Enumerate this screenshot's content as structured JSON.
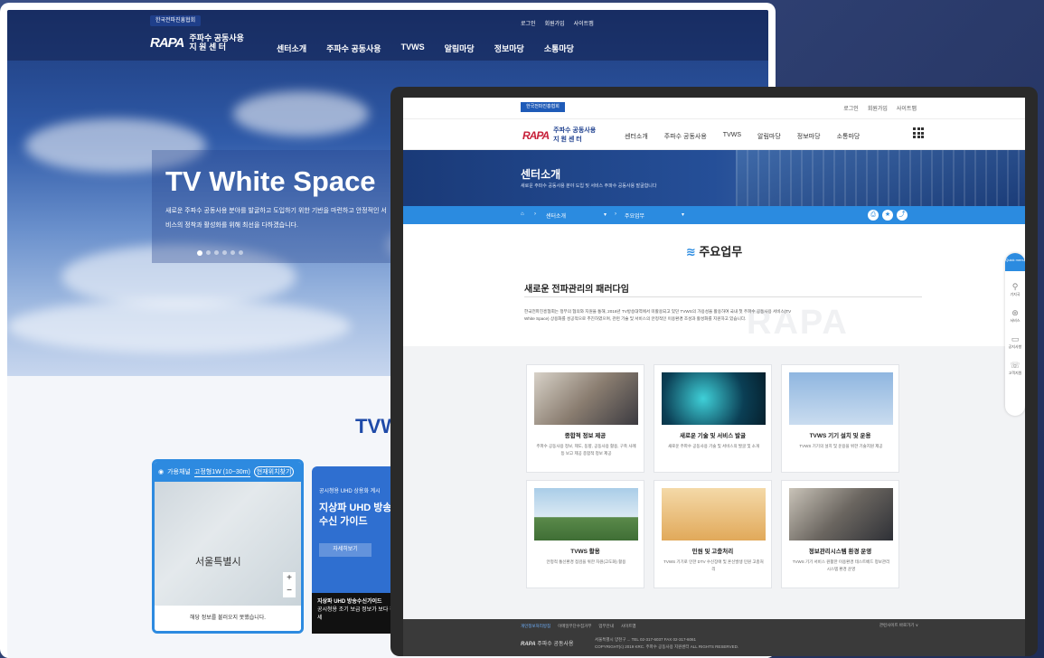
{
  "back": {
    "org_tag": "한국전파진흥협회",
    "logo_mark": "RAPA",
    "logo_line1": "주파수 공동사용",
    "logo_line2": "지 원 센 터",
    "nav": [
      "센터소개",
      "주파수 공동사용",
      "TVWS",
      "알림마당",
      "정보마당",
      "소통마당"
    ],
    "util": [
      "로그인",
      "회원가입",
      "사이트맵"
    ],
    "hero_title": "TV White Space",
    "hero_desc": "새로운 주파수 공동사용 분야를 발굴하고 도입하기 위한 기반을 마련하고 안정적인 서비스의 정착과 활성화를 위해 최선을 다하겠습니다.",
    "section_title": "TVW",
    "map_card": {
      "title": "가용채널",
      "filter": "고정형1W (10~30m)",
      "locate": "현재위치찾기",
      "city": "서울특별시",
      "footer": "해당 정보를 불러오지 못했습니다."
    },
    "guide_card": {
      "small": "공시청용 UHD 상용화 계시",
      "title": "지상파 UHD 방송 수신 가이드",
      "button": "자세히보기",
      "bottom_title": "지상파 UHD 방송수신가이드",
      "bottom_desc": "공시청용 조기 보급 정보가 보다 하세"
    }
  },
  "front": {
    "org_tag": "한국전파진흥협회",
    "util": [
      "로그인",
      "회원가입",
      "사이트맵"
    ],
    "logo_mark": "RAPA",
    "logo_line1": "주파수 공동사용",
    "logo_line2": "지 원 센 터",
    "nav": [
      "센터소개",
      "주파수 공동사용",
      "TVWS",
      "알림마당",
      "정보마당",
      "소통마당"
    ],
    "banner_title": "센터소개",
    "banner_desc": "새로운 주파수 공동사용 분야 도입 및 서비스 주파수 공동사용 발굴합니다",
    "crumbs": [
      "센터소개",
      "주요업무"
    ],
    "page_title": "주요업무",
    "section_title": "새로운 전파관리의 패러다임",
    "section_para": "한국전파진흥협회는 정부의 협의와 지원을 통해, 2016년 TV방송대역에서 미활용되고 있던 TVWS의 가용성을 활용하여 국내 첫 주파수 공동사용 서비스(TV White Space) 상용화를 성공적으로 추진하였으며, 관련 기술 및 서비스의 안정적인 이용환경 조성과 활성화를 지원하고 있습니다.",
    "watermark": "RAPA",
    "cards": [
      {
        "title": "종합적 정보 제공",
        "desc": "주파수 공동사용 정보, 제도, 동향, 공동사용 활용, 구축 사례 등 보고 제공 종합적 정보 제공"
      },
      {
        "title": "새로운 기술 및 서비스 발굴",
        "desc": "새로운 주파수 공동사용 기술 및 서비스의 발굴 및 소개"
      },
      {
        "title": "TVWS 기기 설치 및 운용",
        "desc": "TVWS 기기의 설치 및 운용을 위한 기술지원 제공"
      },
      {
        "title": "TVWS 활용",
        "desc": "안정적 통신환경 점검을 위한 자원(고도화) 활용"
      },
      {
        "title": "민원 및 고충처리",
        "desc": "TVWS 기기로 인한 DTV 수신장애 및 혼신발생 민원 고충처리"
      },
      {
        "title": "정보관리시스템 환경 운영",
        "desc": "TVWS 기기 서비스 원활한 이용환경 테스트베드 정보관리시스템 환경 운영"
      }
    ],
    "quick": {
      "head": "Quick menu",
      "items": [
        "기지국",
        "서비스",
        "공지사항",
        "고객지원"
      ]
    },
    "footer": {
      "links": [
        "개인정보처리방침",
        "이메일무단수집거부",
        "업무안내",
        "사이트맵"
      ],
      "family": "관련사이트 바로가기",
      "address": "서울특별시 양천구 ... TEL 02-317-6037 FAX 02-317-6061",
      "copy": "COPYRIGHT(c) 2019 KRC. 주파수 공동사용 지원센터 ALL RIGHTS RESERVED."
    }
  }
}
